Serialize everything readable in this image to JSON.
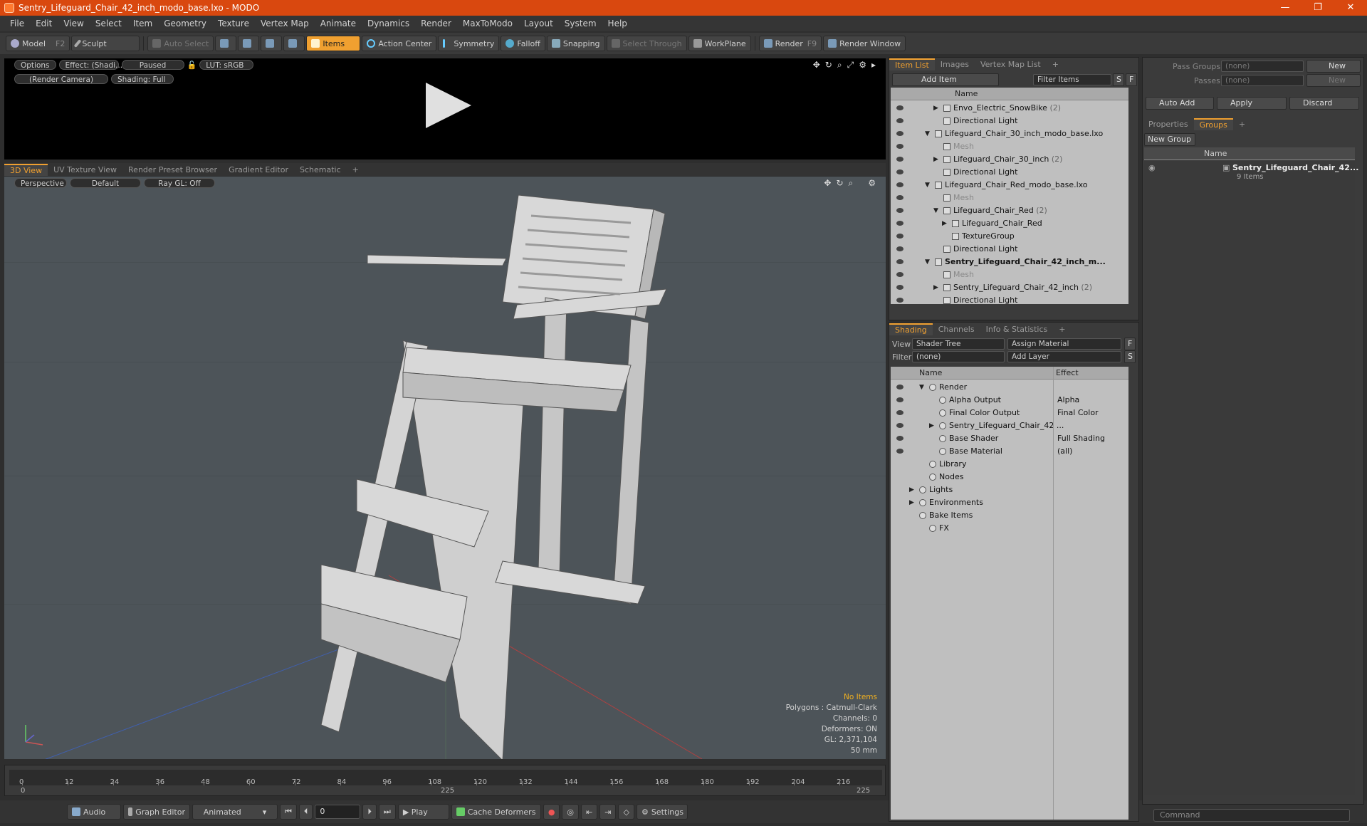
{
  "window": {
    "title": "Sentry_Lifeguard_Chair_42_inch_modo_base.lxo - MODO",
    "min": "—",
    "max": "❐",
    "close": "✕"
  },
  "menu": [
    "File",
    "Edit",
    "View",
    "Select",
    "Item",
    "Geometry",
    "Texture",
    "Vertex Map",
    "Animate",
    "Dynamics",
    "Render",
    "MaxToModo",
    "Layout",
    "System",
    "Help"
  ],
  "toolbar": {
    "model": "Model",
    "model_key": "F2",
    "sculpt": "Sculpt",
    "auto_select": "Auto Select",
    "items": "Items",
    "action_center": "Action Center",
    "symmetry": "Symmetry",
    "falloff": "Falloff",
    "snapping": "Snapping",
    "select_through": "Select Through",
    "workplane": "WorkPlane",
    "render": "Render",
    "render_key": "F9",
    "render_window": "Render Window"
  },
  "render_view": {
    "options": "Options",
    "effect": "Effect: (Shadi...",
    "paused": "Paused",
    "lut": "LUT: sRGB",
    "camera": "(Render Camera)",
    "shading": "Shading: Full"
  },
  "view_tabs": [
    "3D View",
    "UV Texture View",
    "Render Preset Browser",
    "Gradient Editor",
    "Schematic",
    "+"
  ],
  "viewport": {
    "perspective": "Perspective",
    "default": "Default",
    "raygl": "Ray GL: Off"
  },
  "stats": {
    "no_items": "No Items",
    "polygons": "Polygons : Catmull-Clark",
    "channels": "Channels: 0",
    "deformers": "Deformers: ON",
    "gl": "GL: 2,371,104",
    "lens": "50 mm"
  },
  "timeline": {
    "ticks": [
      "0",
      "12",
      "24",
      "36",
      "48",
      "60",
      "72",
      "84",
      "96",
      "108",
      "120",
      "132",
      "144",
      "156",
      "168",
      "180",
      "192",
      "204",
      "216"
    ],
    "start": "0",
    "mid": "225",
    "end": "225"
  },
  "bottom": {
    "audio": "Audio",
    "graph_editor": "Graph Editor",
    "animated": "Animated",
    "frame": "0",
    "play": "Play",
    "cache": "Cache Deformers",
    "settings": "Settings",
    "command": "Command"
  },
  "item_list": {
    "tabs": [
      "Item List",
      "Images",
      "Vertex Map List",
      "+"
    ],
    "add_item": "Add Item",
    "filter": "Filter Items",
    "s": "S",
    "f": "F",
    "col_name": "Name",
    "rows": [
      {
        "indent": 3,
        "text": "Envo_Electric_SnowBike",
        "count": "(2)",
        "tri": "▶",
        "kind": "normal"
      },
      {
        "indent": 3,
        "text": "Directional Light",
        "count": "",
        "tri": "",
        "kind": "normal"
      },
      {
        "indent": 2,
        "text": "Lifeguard_Chair_30_inch_modo_base.lxo",
        "count": "",
        "tri": "▼",
        "kind": "normal"
      },
      {
        "indent": 3,
        "text": "Mesh",
        "count": "",
        "tri": "",
        "kind": "grey"
      },
      {
        "indent": 3,
        "text": "Lifeguard_Chair_30_inch",
        "count": "(2)",
        "tri": "▶",
        "kind": "normal"
      },
      {
        "indent": 3,
        "text": "Directional Light",
        "count": "",
        "tri": "",
        "kind": "normal"
      },
      {
        "indent": 2,
        "text": "Lifeguard_Chair_Red_modo_base.lxo",
        "count": "",
        "tri": "▼",
        "kind": "normal"
      },
      {
        "indent": 3,
        "text": "Mesh",
        "count": "",
        "tri": "",
        "kind": "grey"
      },
      {
        "indent": 3,
        "text": "Lifeguard_Chair_Red",
        "count": "(2)",
        "tri": "▼",
        "kind": "normal"
      },
      {
        "indent": 4,
        "text": "Lifeguard_Chair_Red",
        "count": "",
        "tri": "▶",
        "kind": "normal"
      },
      {
        "indent": 4,
        "text": "TextureGroup",
        "count": "",
        "tri": "",
        "kind": "normal"
      },
      {
        "indent": 3,
        "text": "Directional Light",
        "count": "",
        "tri": "",
        "kind": "normal"
      },
      {
        "indent": 2,
        "text": "Sentry_Lifeguard_Chair_42_inch_m...",
        "count": "",
        "tri": "▼",
        "kind": "bold"
      },
      {
        "indent": 3,
        "text": "Mesh",
        "count": "",
        "tri": "",
        "kind": "grey"
      },
      {
        "indent": 3,
        "text": "Sentry_Lifeguard_Chair_42_inch",
        "count": "(2)",
        "tri": "▶",
        "kind": "normal"
      },
      {
        "indent": 3,
        "text": "Directional Light",
        "count": "",
        "tri": "",
        "kind": "normal"
      }
    ]
  },
  "shading": {
    "tabs": [
      "Shading",
      "Channels",
      "Info & Statistics",
      "+"
    ],
    "view_label": "View",
    "view_value": "Shader Tree",
    "assign": "Assign Material",
    "filter_label": "Filter",
    "filter_value": "(none)",
    "add_layer": "Add Layer",
    "f": "F",
    "s": "S",
    "col_name": "Name",
    "col_effect": "Effect",
    "rows": [
      {
        "indent": 1,
        "text": "Render",
        "effect": "",
        "tri": "▼",
        "eye": true
      },
      {
        "indent": 2,
        "text": "Alpha Output",
        "effect": "Alpha",
        "tri": "",
        "eye": true
      },
      {
        "indent": 2,
        "text": "Final Color Output",
        "effect": "Final Color",
        "tri": "",
        "eye": true
      },
      {
        "indent": 2,
        "text": "Sentry_Lifeguard_Chair_42 ...",
        "effect": "",
        "tri": "▶",
        "eye": true
      },
      {
        "indent": 2,
        "text": "Base Shader",
        "effect": "Full Shading",
        "tri": "",
        "eye": true
      },
      {
        "indent": 2,
        "text": "Base Material",
        "effect": "(all)",
        "tri": "",
        "eye": true
      },
      {
        "indent": 1,
        "text": "Library",
        "effect": "",
        "tri": "",
        "eye": false
      },
      {
        "indent": 1,
        "text": "Nodes",
        "effect": "",
        "tri": "",
        "eye": false
      },
      {
        "indent": 0,
        "text": "Lights",
        "effect": "",
        "tri": "▶",
        "eye": false
      },
      {
        "indent": 0,
        "text": "Environments",
        "effect": "",
        "tri": "▶",
        "eye": false
      },
      {
        "indent": 0,
        "text": "Bake Items",
        "effect": "",
        "tri": "",
        "eye": false
      },
      {
        "indent": 1,
        "text": "FX",
        "effect": "",
        "tri": "",
        "eye": false
      }
    ]
  },
  "groups": {
    "pass_groups": "Pass Groups",
    "pass_val": "(none)",
    "new": "New",
    "passes": "Passes",
    "passes_val": "(none)",
    "new2": "New",
    "auto_add": "Auto Add",
    "apply": "Apply",
    "discard": "Discard",
    "tabs": [
      "Properties",
      "Groups",
      "+"
    ],
    "new_group": "New Group",
    "col_name": "Name",
    "item": "Sentry_Lifeguard_Chair_42...",
    "item_sub": "9 Items"
  }
}
